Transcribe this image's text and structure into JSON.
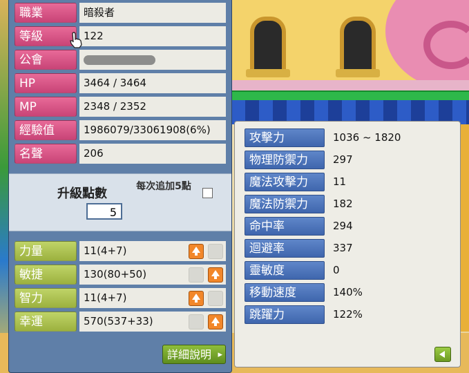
{
  "basic_stats": [
    {
      "label": "職業",
      "value": "暗殺者"
    },
    {
      "label": "等級",
      "value": "122"
    },
    {
      "label": "公會",
      "value": ""
    },
    {
      "label": "HP",
      "value": "3464 / 3464"
    },
    {
      "label": "MP",
      "value": "2348 / 2352"
    },
    {
      "label": "經驗值",
      "value": "1986079/33061908(6%)"
    },
    {
      "label": "名聲",
      "value": "206"
    }
  ],
  "ability_points": {
    "label": "升級點數",
    "value": "5",
    "each_add_label": "每次追加5點",
    "each_add_checked": false
  },
  "primary_stats": [
    {
      "label": "力量",
      "value": "11(4+7)",
      "can_add": true
    },
    {
      "label": "敏捷",
      "value": "130(80+50)",
      "can_add": true
    },
    {
      "label": "智力",
      "value": "11(4+7)",
      "can_add": true
    },
    {
      "label": "幸運",
      "value": "570(537+33)",
      "can_add": true
    }
  ],
  "detail_button": {
    "label": "詳細說明",
    "icon": "chevron-right-icon"
  },
  "detail_stats": [
    {
      "label": "攻擊力",
      "value": "1036 ~ 1820"
    },
    {
      "label": "物理防禦力",
      "value": "297"
    },
    {
      "label": "魔法攻擊力",
      "value": "11"
    },
    {
      "label": "魔法防禦力",
      "value": "182"
    },
    {
      "label": "命中率",
      "value": "294"
    },
    {
      "label": "迴避率",
      "value": "337"
    },
    {
      "label": "靈敏度",
      "value": "0"
    },
    {
      "label": "移動速度",
      "value": "140%"
    },
    {
      "label": "跳躍力",
      "value": "122%"
    }
  ],
  "close_detail_icon": "arrow-left-icon",
  "colors": {
    "pink_label": "#d4527f",
    "lime_label": "#aec24f",
    "blue_label": "#4a72b8",
    "orange_button": "#f2872a",
    "panel_blue": "#5f7fa8"
  }
}
